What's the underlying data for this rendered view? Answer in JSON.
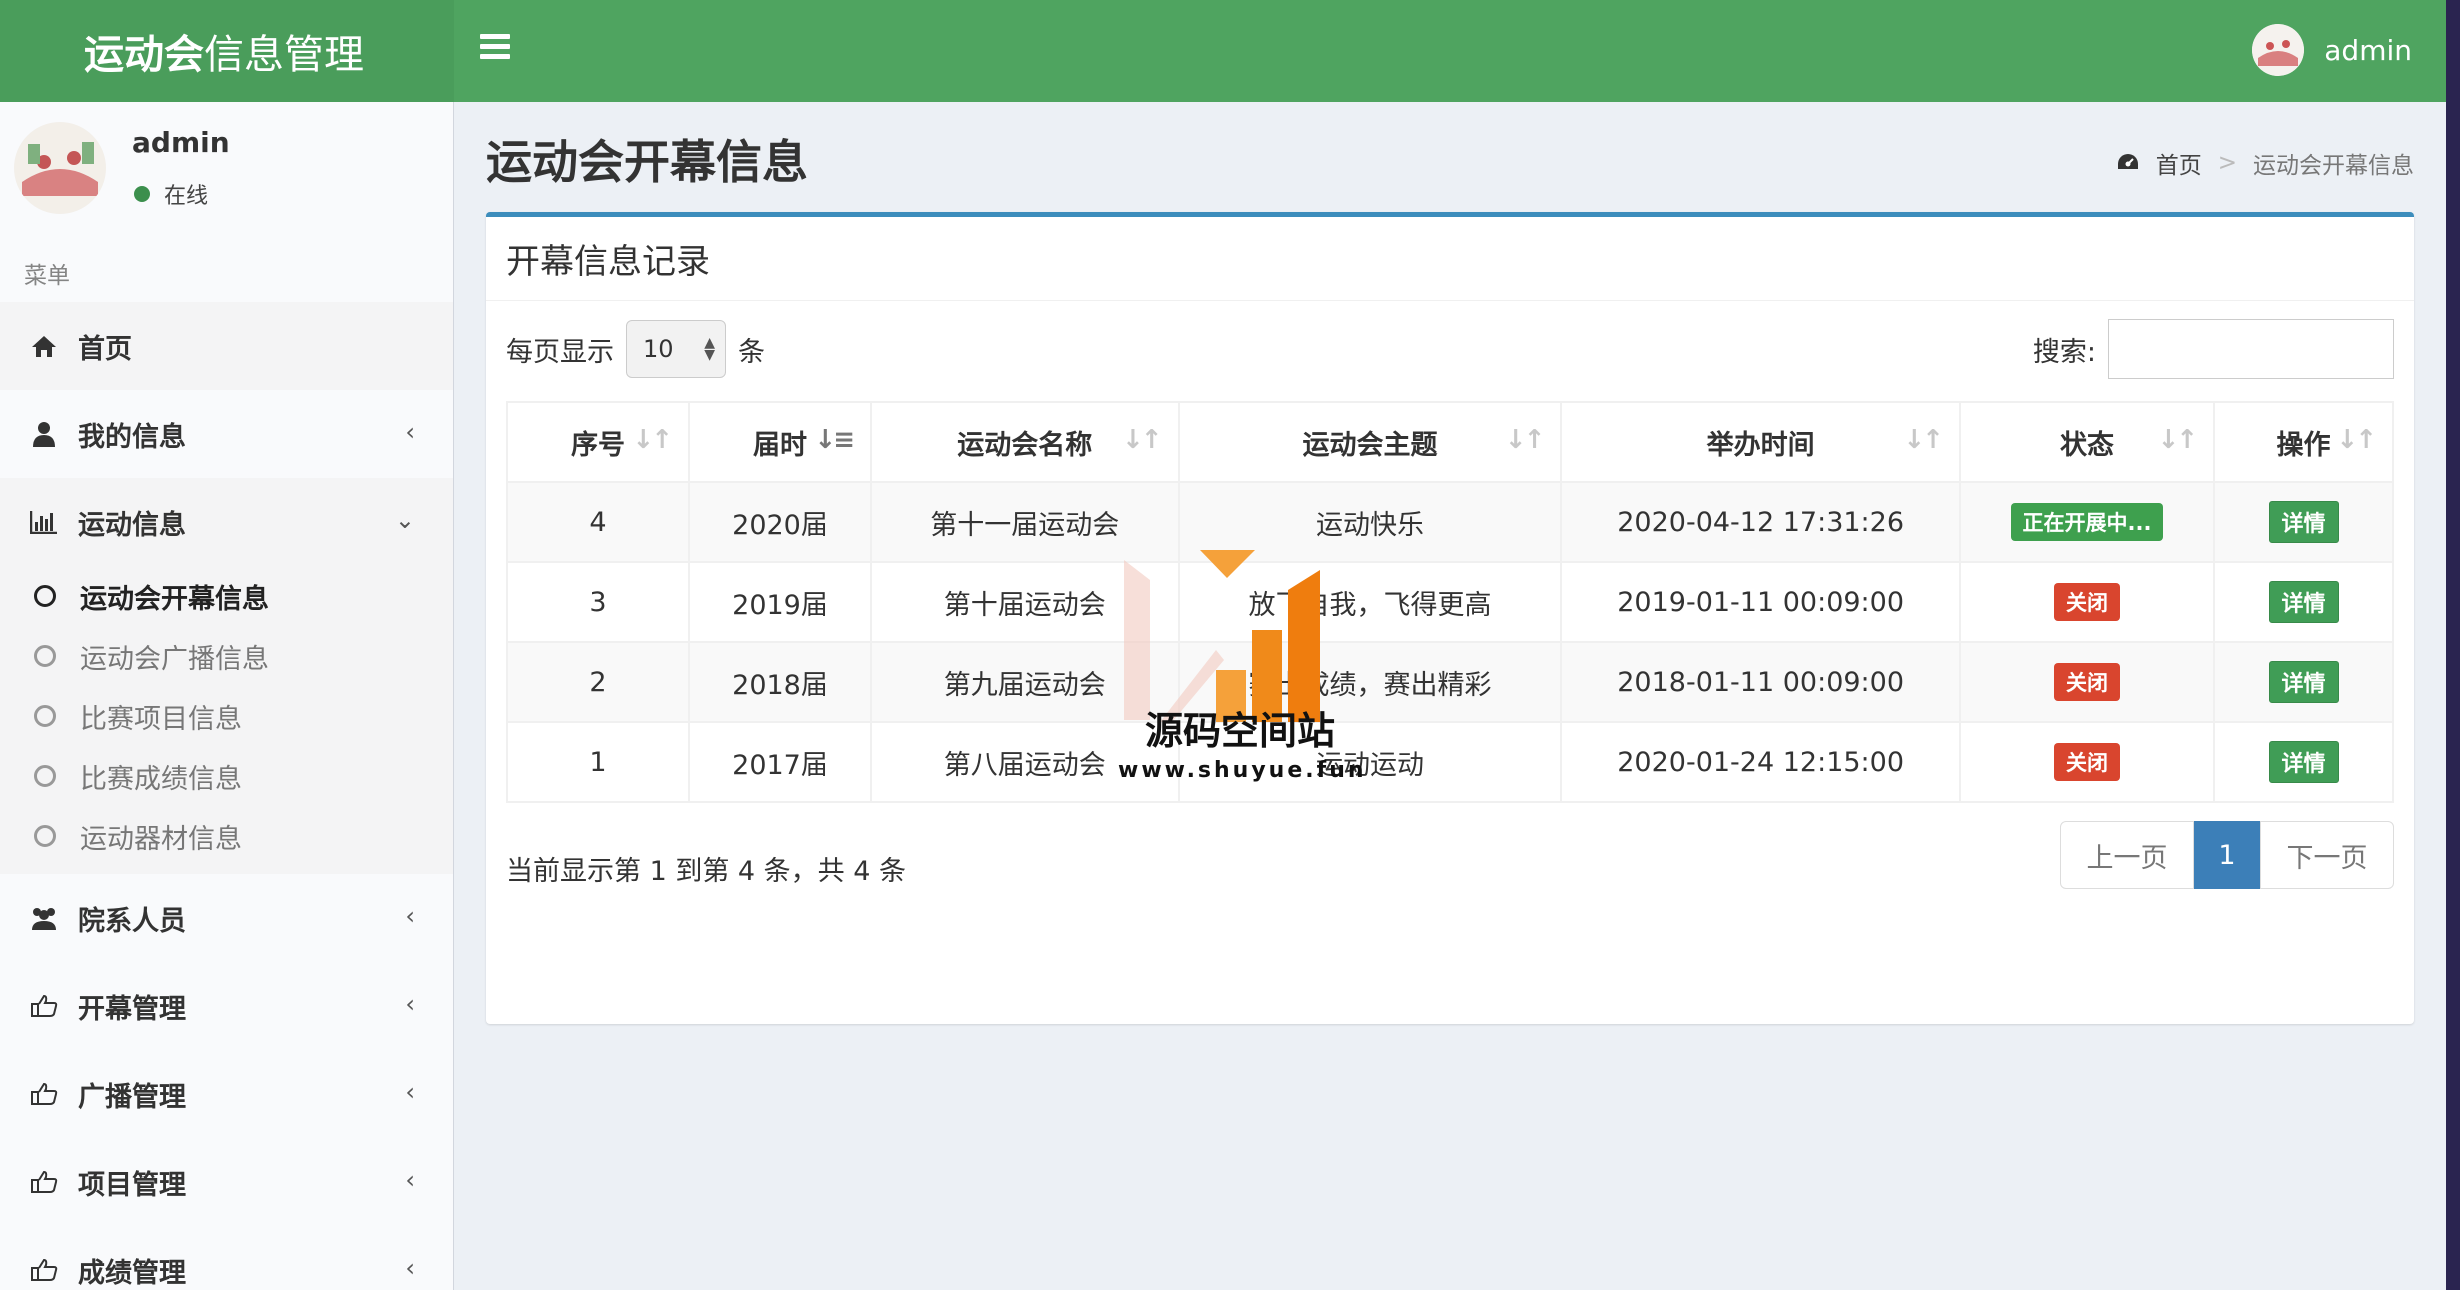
{
  "app": {
    "title_bold": "运动会",
    "title_rest": "信息管理"
  },
  "header": {
    "username": "admin"
  },
  "user_panel": {
    "name": "admin",
    "status": "在线"
  },
  "sidebar": {
    "menu_header": "菜单",
    "items": [
      {
        "label": "首页",
        "icon": "home-icon"
      },
      {
        "label": "我的信息",
        "icon": "user-icon"
      },
      {
        "label": "运动信息",
        "icon": "bar-chart-icon"
      }
    ],
    "sub_items": [
      {
        "label": "运动会开幕信息"
      },
      {
        "label": "运动会广播信息"
      },
      {
        "label": "比赛项目信息"
      },
      {
        "label": "比赛成绩信息"
      },
      {
        "label": "运动器材信息"
      }
    ],
    "items_after": [
      {
        "label": "院系人员",
        "icon": "users-icon"
      },
      {
        "label": "开幕管理",
        "icon": "thumbs-up-icon"
      },
      {
        "label": "广播管理",
        "icon": "thumbs-up-icon"
      },
      {
        "label": "项目管理",
        "icon": "thumbs-up-icon"
      },
      {
        "label": "成绩管理",
        "icon": "thumbs-up-icon"
      }
    ]
  },
  "page": {
    "title": "运动会开幕信息",
    "breadcrumb": {
      "home": "首页",
      "sep": ">",
      "current": "运动会开幕信息"
    }
  },
  "box": {
    "title": "开幕信息记录",
    "length_prefix": "每页显示",
    "length_value": "10",
    "length_suffix": "条",
    "search_label": "搜索:",
    "search_value": ""
  },
  "table": {
    "columns": [
      "序号",
      "届时",
      "运动会名称",
      "运动会主题",
      "举办时间",
      "状态",
      "操作"
    ],
    "rows": [
      {
        "id": "4",
        "session": "2020届",
        "name": "第十一届运动会",
        "theme": "运动快乐",
        "time": "2020-04-12 17:31:26",
        "status": "正在开展中...",
        "action": "详情"
      },
      {
        "id": "3",
        "session": "2019届",
        "name": "第十届运动会",
        "theme": "放飞自我，飞得更高",
        "time": "2019-01-11 00:09:00",
        "status": "关闭",
        "action": "详情"
      },
      {
        "id": "2",
        "session": "2018届",
        "name": "第九届运动会",
        "theme": "赛出成绩，赛出精彩",
        "time": "2018-01-11 00:09:00",
        "status": "关闭",
        "action": "详情"
      },
      {
        "id": "1",
        "session": "2017届",
        "name": "第八届运动会",
        "theme": "运动运动",
        "time": "2020-01-24 12:15:00",
        "status": "关闭",
        "action": "详情"
      }
    ]
  },
  "footer": {
    "info": "当前显示第 1 到第 4 条，共 4 条",
    "prev": "上一页",
    "current_page": "1",
    "next": "下一页"
  },
  "watermark": {
    "name": "源码空间站",
    "url": "www.shuyue.fun"
  },
  "colors": {
    "header": "#4fa460",
    "box_border": "#3c8dbc",
    "badge_green": "#3ea04e",
    "badge_red": "#d9452e",
    "detail_button": "#409d56",
    "pager_active": "#3c7fb8"
  }
}
